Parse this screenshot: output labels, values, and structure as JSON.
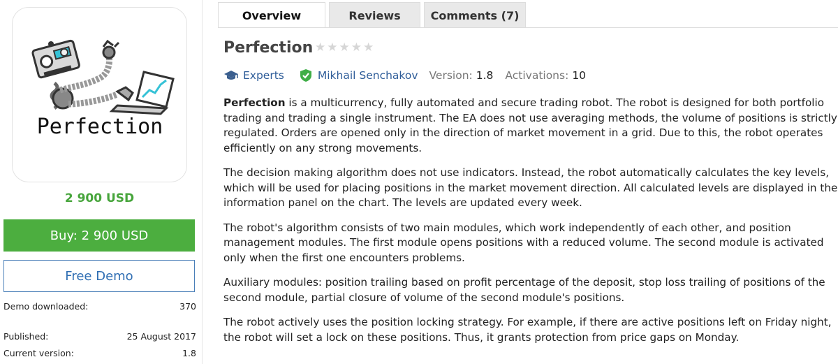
{
  "product": {
    "logo_text": "Perfection",
    "price": "2 900 USD",
    "buy_label": "Buy: 2 900 USD",
    "demo_label": "Free Demo",
    "info": [
      {
        "label": "Demo downloaded:",
        "value": "370"
      },
      {
        "label": "Published:",
        "value": "25 August 2017"
      },
      {
        "label": "Current version:",
        "value": "1.8"
      }
    ]
  },
  "tabs": [
    {
      "label": "Overview",
      "active": true
    },
    {
      "label": "Reviews",
      "active": false
    },
    {
      "label": "Comments (7)",
      "active": false
    }
  ],
  "header": {
    "title": "Perfection",
    "rating": 0,
    "category": "Experts",
    "category_icon": "graduation-cap-icon",
    "author": "Mikhail Senchakov",
    "author_icon": "verified-shield-icon",
    "version_label": "Version:",
    "version": "1.8",
    "activations_label": "Activations:",
    "activations": "10"
  },
  "description": {
    "p1_lead": "Perfection",
    "p1_rest": " is a multicurrency, fully automated and secure trading robot. The robot is designed for both portfolio trading and trading a single instrument. The EA does not use averaging methods, the volume of positions is strictly regulated. Orders are opened only in the direction of market movement in a grid. Due to this, the robot operates efficiently on any strong movements.",
    "p2": "The decision making algorithm does not use indicators. Instead, the robot automatically calculates the key levels, which will be used for placing positions in the market movement direction. All calculated levels are displayed in the information panel on the chart. The levels are updated every week.",
    "p3": "The robot's algorithm consists of two main modules, which work independently of each other, and position management modules. The first module opens positions with a reduced volume. The second module is activated only when the first one encounters problems.",
    "p4": "Auxiliary modules: position trailing based on profit percentage of the deposit, stop loss trailing of positions of the second module, partial closure of volume of the second module's positions.",
    "p5": "The robot actively uses the position locking strategy. For example, if there are active positions left on Friday night, the robot will set a lock on these positions. Thus, it grants protection from price gaps on Monday."
  },
  "colors": {
    "accent_green": "#4cae3f",
    "price_green": "#47a53c",
    "link_blue": "#2f5d99",
    "demo_blue": "#2f6eb3"
  }
}
